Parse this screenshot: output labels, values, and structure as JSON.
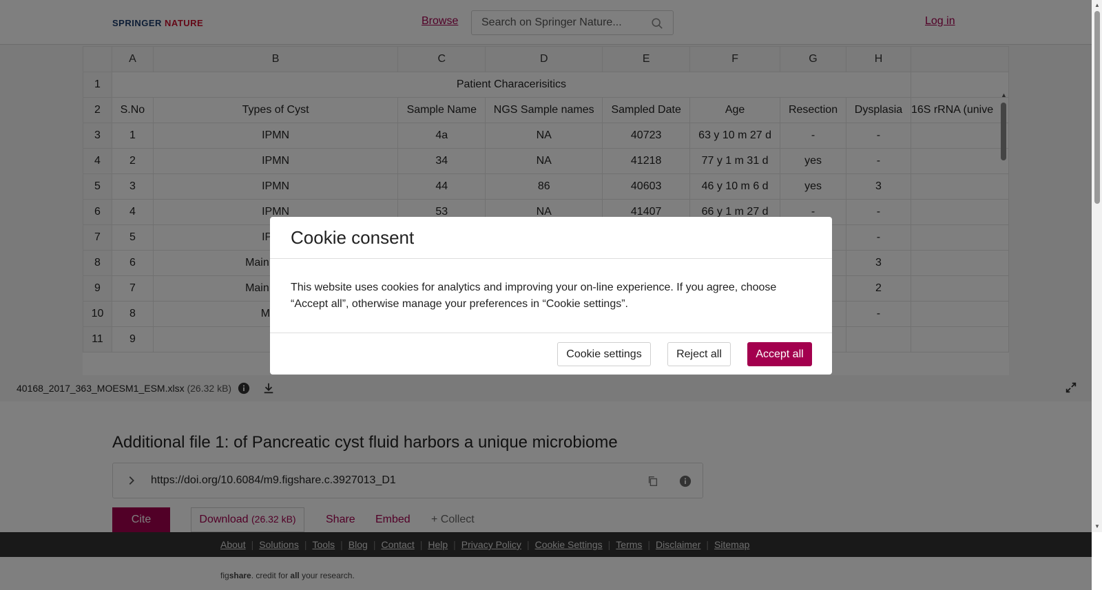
{
  "header": {
    "logo_part1": "SPRINGER",
    "logo_part2": " NATURE",
    "browse": "Browse",
    "search_placeholder": "Search on Springer Nature...",
    "login": "Log in"
  },
  "spreadsheet": {
    "column_headers": [
      "",
      "A",
      "B",
      "C",
      "D",
      "E",
      "F",
      "G",
      "H",
      ""
    ],
    "rows": [
      {
        "n": "1",
        "merged": "Patient Characerisitics"
      },
      {
        "n": "2",
        "cells": [
          "S.No",
          "Types of Cyst",
          "Sample Name",
          "NGS Sample names",
          "Sampled Date",
          "Age",
          "Resection",
          "Dysplasia",
          "16S rRNA (unive"
        ]
      },
      {
        "n": "3",
        "cells": [
          "1",
          "IPMN",
          "4a",
          "NA",
          "40723",
          "63 y 10 m 27 d",
          "-",
          "-",
          ""
        ]
      },
      {
        "n": "4",
        "cells": [
          "2",
          "IPMN",
          "34",
          "NA",
          "41218",
          "77 y 1 m 31 d",
          "yes",
          "-",
          ""
        ]
      },
      {
        "n": "5",
        "cells": [
          "3",
          "IPMN",
          "44",
          "86",
          "40603",
          "46 y 10 m 6 d",
          "yes",
          "3",
          ""
        ]
      },
      {
        "n": "6",
        "cells": [
          "4",
          "IPMN",
          "53",
          "NA",
          "41407",
          "66 y 1 m 27 d",
          "-",
          "-",
          ""
        ]
      },
      {
        "n": "7",
        "cells": [
          "5",
          "IPMN",
          "",
          "",
          "",
          "",
          "",
          "-",
          ""
        ]
      },
      {
        "n": "8",
        "cells": [
          "6",
          "Main branch",
          "",
          "",
          "",
          "",
          "",
          "3",
          ""
        ]
      },
      {
        "n": "9",
        "cells": [
          "7",
          "Main branch",
          "",
          "",
          "",
          "",
          "",
          "2",
          ""
        ]
      },
      {
        "n": "10",
        "cells": [
          "8",
          "Mixed",
          "",
          "",
          "",
          "",
          "",
          "-",
          ""
        ]
      },
      {
        "n": "11",
        "cells": [
          "9",
          "",
          "",
          "",
          "",
          "",
          "",
          "",
          ""
        ]
      }
    ]
  },
  "filebar": {
    "filename": "40168_2017_363_MOESM1_ESM.xlsx",
    "size": "(26.32 kB)"
  },
  "main": {
    "title": "Additional file 1: of Pancreatic cyst fluid harbors a unique microbiome",
    "doi": "https://doi.org/10.6084/m9.figshare.c.3927013_D1",
    "cite": "Cite",
    "download": "Download",
    "download_size": "(26.32 kB)",
    "share": "Share",
    "embed": "Embed",
    "collect": "+ Collect"
  },
  "footer": {
    "links": [
      "About",
      "Solutions",
      "Tools",
      "Blog",
      "Contact",
      "Help",
      "Privacy Policy",
      "Cookie Settings",
      "Terms",
      "Disclaimer",
      "Sitemap"
    ],
    "tagline_fig": "fig",
    "tagline_share": "share",
    "tagline_mid": ". credit for ",
    "tagline_all": "all",
    "tagline_end": " your research."
  },
  "cookie_modal": {
    "title": "Cookie consent",
    "body": "This website uses cookies for analytics and improving your on-line experience. If you agree, choose “Accept all”, otherwise manage your preferences in “Cookie settings”.",
    "settings_button": "Cookie settings",
    "reject_button": "Reject all",
    "accept_button": "Accept all"
  },
  "colors": {
    "accent": "#a3004e",
    "footer_bg": "#333333"
  }
}
